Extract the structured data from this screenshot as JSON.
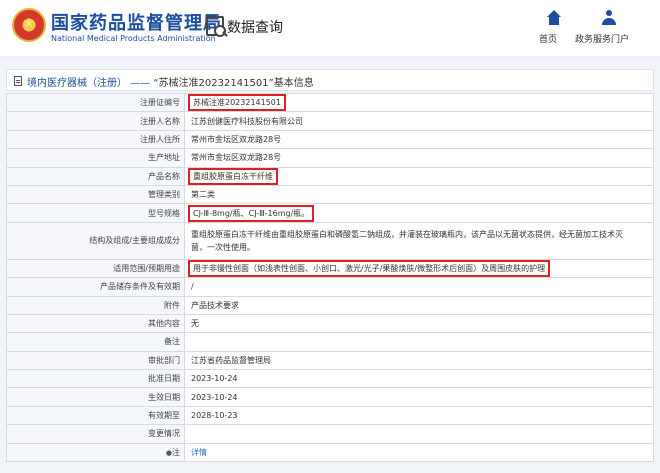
{
  "header": {
    "org_name_cn": "国家药品监督管理局",
    "org_name_en": "National Medical Products Administration",
    "section_title": "数据查询",
    "nav": [
      {
        "label": "首页",
        "icon": "home-icon"
      },
      {
        "label": "政务服务门户",
        "icon": "user-icon"
      }
    ]
  },
  "breadcrumb": {
    "category": "境内医疗器械（注册）",
    "separator": "——",
    "record": "“苏械注准20232141501”基本信息"
  },
  "details": [
    {
      "key": "注册证编号",
      "value": "苏械注准20232141501",
      "highlight": true
    },
    {
      "key": "注册人名称",
      "value": "江苏创健医疗科技股份有限公司"
    },
    {
      "key": "注册人住所",
      "value": "常州市金坛区双龙路28号"
    },
    {
      "key": "生产地址",
      "value": "常州市金坛区双龙路28号"
    },
    {
      "key": "产品名称",
      "value": "重组胶原蛋白冻干纤维",
      "highlight": true
    },
    {
      "key": "管理类别",
      "value": "第二类"
    },
    {
      "key": "型号规格",
      "value": "CJ-Ⅲ-8mg/瓶、CJ-Ⅲ-16mg/瓶。",
      "highlight": true
    },
    {
      "key": "结构及组成/主要组成成分",
      "value": "重组胶原蛋白冻干纤维由重组胶原蛋白和磷酸氢二钠组成，并灌装在玻璃瓶内，该产品以无菌状态提供，经无菌加工技术灭菌，一次性使用。",
      "tall": true
    },
    {
      "key": "适用范围/预期用途",
      "value": "用于非慢性创面（如浅表性创面、小创口、激光/光子/果酸焕肤/微整形术后创面）及周围皮肤的护理",
      "highlight": true
    },
    {
      "key": "产品储存条件及有效期",
      "value": "/"
    },
    {
      "key": "附件",
      "value": "产品技术要求"
    },
    {
      "key": "其他内容",
      "value": "无"
    },
    {
      "key": "备注",
      "value": ""
    },
    {
      "key": "审批部门",
      "value": "江苏省药品监督管理局"
    },
    {
      "key": "批准日期",
      "value": "2023-10-24"
    },
    {
      "key": "生效日期",
      "value": "2023-10-24"
    },
    {
      "key": "有效期至",
      "value": "2028-10-23"
    },
    {
      "key": "变更情况",
      "value": ""
    },
    {
      "key": "注",
      "key_icon": "pin-icon",
      "value": "详情",
      "link": true
    }
  ],
  "colors": {
    "brand_blue": "#1b4e9c",
    "highlight_red": "#e02020",
    "link_blue": "#1b6ec2"
  }
}
